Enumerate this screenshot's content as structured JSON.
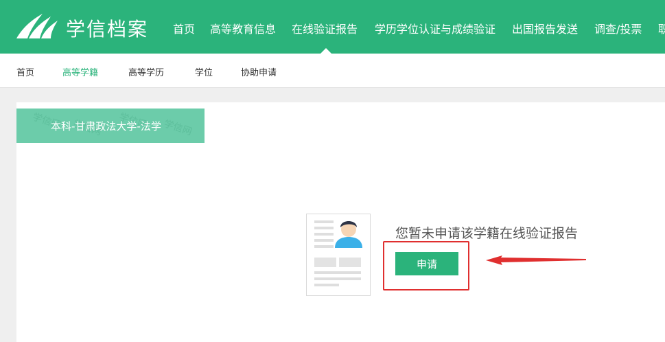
{
  "header": {
    "brand": "学信档案",
    "nav": [
      "首页",
      "高等教育信息",
      "在线验证报告",
      "学历学位认证与成绩验证",
      "出国报告发送",
      "调查/投票",
      "职"
    ],
    "active_index": 2
  },
  "subnav": {
    "items": [
      "首页",
      "高等学籍",
      "高等学历",
      "学位",
      "协助申请"
    ],
    "active_index": 1
  },
  "record": {
    "label": "本科-甘肃政法大学-法学",
    "watermark": "学信网"
  },
  "empty_state": {
    "message": "您暂未申请该学籍在线验证报告",
    "apply_label": "申请"
  },
  "colors": {
    "brand_green": "#2bb37b",
    "tab_green": "#6cccaa",
    "annotation_red": "#e02f2f"
  }
}
